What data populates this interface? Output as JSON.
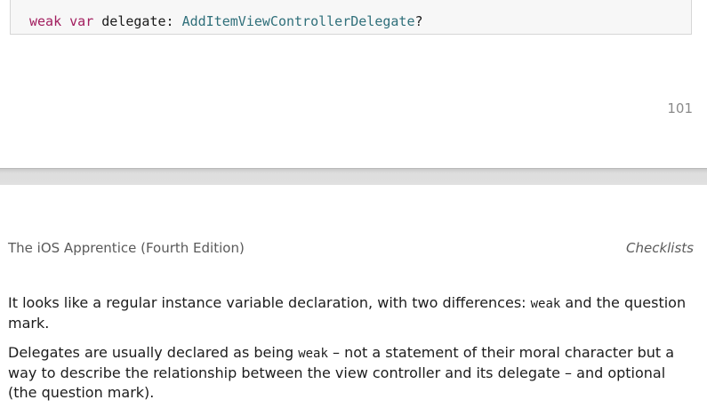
{
  "code": {
    "keyword_weak": "weak",
    "keyword_var": "var",
    "identifier": "delegate:",
    "type_name": "AddItemViewControllerDelegate",
    "optional_mark": "?"
  },
  "page_number": "101",
  "running_header": {
    "book_title": "The iOS Apprentice (Fourth Edition)",
    "chapter_title": "Checklists"
  },
  "paragraphs": {
    "p1_before": "It looks like a regular instance variable declaration, with two differences: ",
    "p1_code": "weak",
    "p1_after": " and the question mark.",
    "p2_before": "Delegates are usually declared as being ",
    "p2_code": "weak",
    "p2_after": " – not a statement of their moral character but a way to describe the relationship between the view controller and its delegate – and optional (the question mark)."
  },
  "colors": {
    "keyword": "#a21d5e",
    "type": "#2f6f7a",
    "page_break": "#dddddd"
  }
}
